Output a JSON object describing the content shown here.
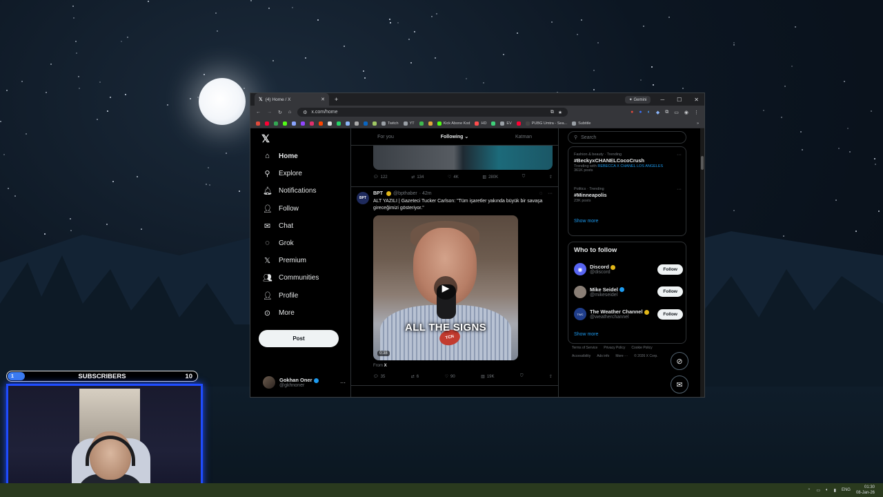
{
  "desktop": {
    "taskbar": {
      "lang": "ENG",
      "time": "01:30",
      "date": "08-Jan-26"
    }
  },
  "overlay": {
    "subscribers": {
      "left": "1",
      "label": "SUBSCRIBERS",
      "goal": "10",
      "progress_fraction": 0.09
    }
  },
  "browser": {
    "tab_title": "(4) Home / X",
    "gemini_label": "Gemini",
    "url": "x.com/home",
    "bookmarks": [
      {
        "label": "",
        "color": "#e24a3b"
      },
      {
        "label": "",
        "color": "#ff0033"
      },
      {
        "label": "",
        "color": "#34a853"
      },
      {
        "label": "",
        "color": "#53fc18"
      },
      {
        "label": "",
        "color": "#8aa4ff"
      },
      {
        "label": "",
        "color": "#9146ff"
      },
      {
        "label": "",
        "color": "#e1306c"
      },
      {
        "label": "",
        "color": "#ff4500"
      },
      {
        "label": "",
        "color": "#dddddd"
      },
      {
        "label": "",
        "color": "#25d366"
      },
      {
        "label": "",
        "color": "#8ab4f8"
      },
      {
        "label": "",
        "color": "#aaaaaa"
      },
      {
        "label": "",
        "color": "#0a66c2"
      },
      {
        "label": "",
        "color": "#a0c864"
      },
      {
        "label": "Twitch",
        "color": "#9aa0a6"
      },
      {
        "label": "YT",
        "color": "#9aa0a6"
      },
      {
        "label": "",
        "color": "#3fb950"
      },
      {
        "label": "",
        "color": "#e2a63b"
      },
      {
        "label": "Kick Abone Kod",
        "color": "#53fc18"
      },
      {
        "label": "HD",
        "color": "#ff4d4d"
      },
      {
        "label": "",
        "color": "#3fd07a"
      },
      {
        "label": "EV",
        "color": "#9aa0a6"
      },
      {
        "label": "",
        "color": "#ff0033"
      },
      {
        "label": "PUBG Umtra - Sea...",
        "color": "#444444"
      },
      {
        "label": "Subtitle",
        "color": "#9aa0a6"
      }
    ]
  },
  "x": {
    "nav": [
      {
        "label": "Home",
        "icon": "home-icon",
        "glyph": "⌂"
      },
      {
        "label": "Explore",
        "icon": "search-icon",
        "glyph": "⚲"
      },
      {
        "label": "Notifications",
        "icon": "bell-icon",
        "glyph": "🔔︎"
      },
      {
        "label": "Follow",
        "icon": "person-add-icon",
        "glyph": "👤︎"
      },
      {
        "label": "Chat",
        "icon": "envelope-icon",
        "glyph": "✉"
      },
      {
        "label": "Grok",
        "icon": "grok-icon",
        "glyph": "◌"
      },
      {
        "label": "Premium",
        "icon": "x-premium-icon",
        "glyph": "𝕏"
      },
      {
        "label": "Communities",
        "icon": "communities-icon",
        "glyph": "👥︎"
      },
      {
        "label": "Profile",
        "icon": "profile-icon",
        "glyph": "👤︎"
      },
      {
        "label": "More",
        "icon": "more-circle-icon",
        "glyph": "⊙"
      }
    ],
    "post_button": "Post",
    "user": {
      "name": "Gokhan Oner",
      "handle": "@gkhnoner"
    },
    "timeline_tabs": [
      "For you",
      "Following",
      "Katman"
    ],
    "prev_tweet_actions": {
      "replies": "122",
      "reposts": "134",
      "likes": "4K",
      "views": "280K"
    },
    "tweet": {
      "avatar_text": "BPT",
      "name": "BPT",
      "handle": "@bpthaber",
      "age": "· 42m",
      "text": "ALT YAZILI | Gazeteci Tucker Carlson: \"Tüm işaretler yakında büyük bir savaşa gireceğimizi gösteriyor.\"",
      "video_caption": "ALL THE SIGNS",
      "video_logo": "TCN",
      "video_time": "0:38",
      "from_prefix": "From",
      "from_source": "X",
      "replies": "35",
      "reposts": "6",
      "likes": "90",
      "views": "19K"
    },
    "search_placeholder": "Search",
    "trends": [
      {
        "category": "Fashion & beauty · Trending",
        "tag": "#BeckyxCHANELCocoCrush",
        "sub_prefix": "Trending with",
        "sub_link": "REBECCA X CHANEL LOS ANGELES",
        "posts": "361K posts"
      },
      {
        "category": "Politics · Trending",
        "tag": "#Minneapolis",
        "posts": "23K posts"
      }
    ],
    "trends_show_more": "Show more",
    "who_to_follow": {
      "title": "Who to follow",
      "accounts": [
        {
          "name": "Discord",
          "handle": "@discord",
          "badge": "gold",
          "avatar_color": "#5865f2",
          "avatar_text": "◉"
        },
        {
          "name": "Mike Seidel",
          "handle": "@mikeseidel",
          "badge": "blue",
          "avatar_color": "#8a7f76",
          "avatar_text": ""
        },
        {
          "name": "The Weather Channel",
          "handle": "@weatherchannel",
          "badge": "gold",
          "avatar_color": "#1f3d8a",
          "avatar_text": "TWC"
        }
      ],
      "follow_label": "Follow",
      "show_more": "Show more"
    },
    "footer": [
      "Terms of Service",
      "Privacy Policy",
      "Cookie Policy",
      "Accessibility",
      "Ads info",
      "More ···",
      "© 2026 X Corp."
    ]
  }
}
